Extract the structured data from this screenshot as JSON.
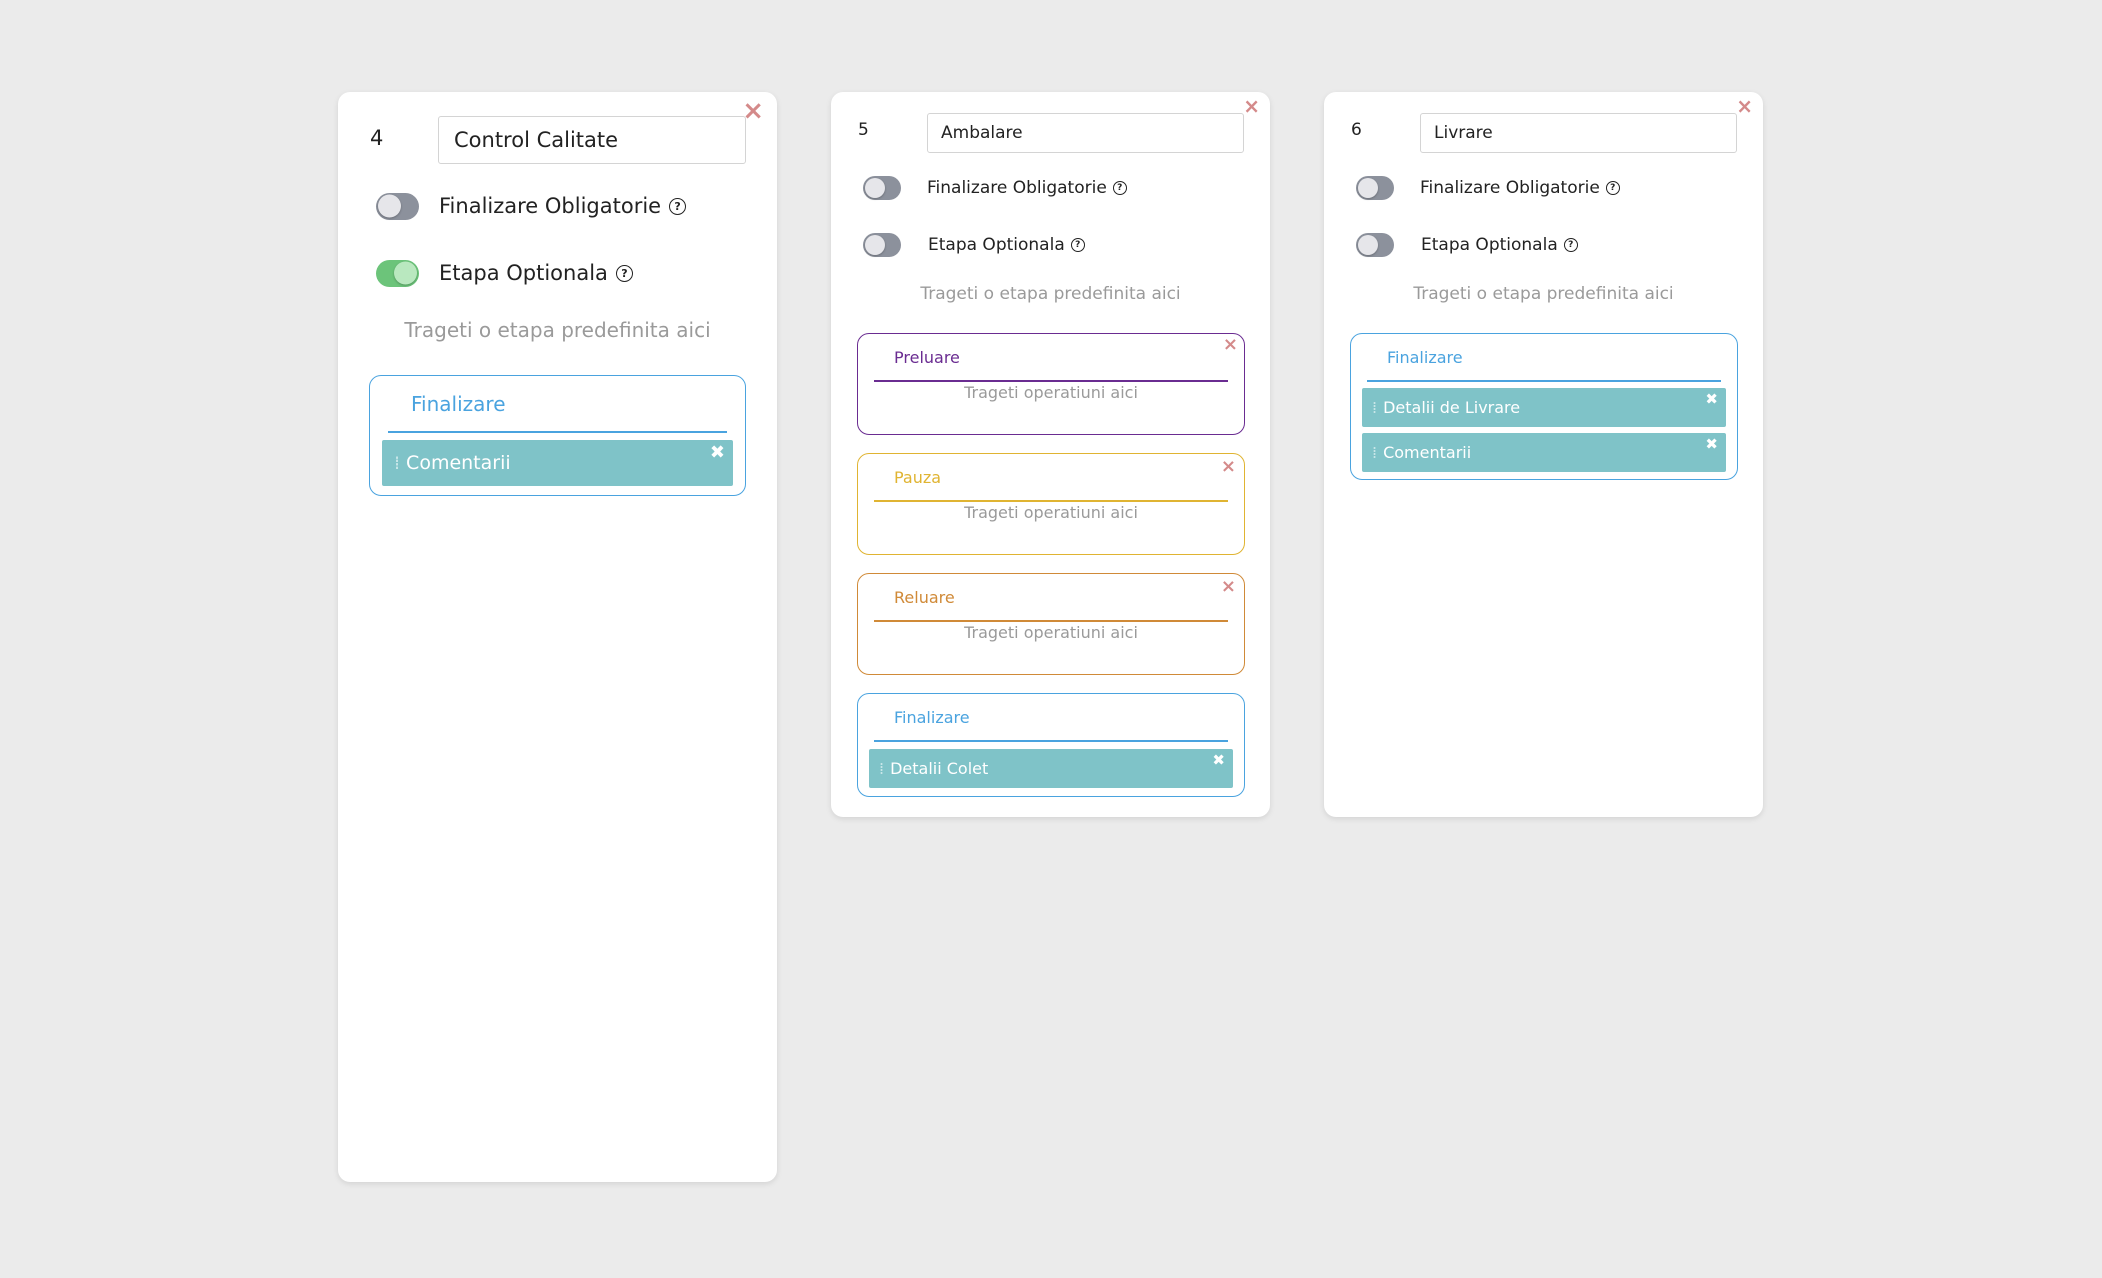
{
  "colors": {
    "background": "#ebebeb",
    "finalizare": "#4aa3df",
    "preluare": "#6a2c91",
    "pauza": "#e0b432",
    "reluare": "#d08a38",
    "operation_item": "#7fc3c8",
    "toggle_on": "#6cc47a",
    "toggle_off": "#8c919c",
    "close_icon": "#d48a8a"
  },
  "icons": {
    "close": "×",
    "help": "?",
    "item_close": "✖",
    "grip": "⁞"
  },
  "stages": [
    {
      "number": "4",
      "name_value": "Control Calitate",
      "toggle_final_label": "Finalizare Obligatorie",
      "toggle_final_on": false,
      "toggle_optional_label": "Etapa Optionala",
      "toggle_optional_on": true,
      "drop_hint": "Trageti o etapa predefinita aici",
      "sections": [
        {
          "title": "Finalizare",
          "items": [
            "Comentarii"
          ]
        }
      ]
    },
    {
      "number": "5",
      "name_value": "Ambalare",
      "toggle_final_label": "Finalizare Obligatorie",
      "toggle_final_on": false,
      "toggle_optional_label": "Etapa Optionala",
      "toggle_optional_on": false,
      "drop_hint": "Trageti o etapa predefinita aici",
      "sections": [
        {
          "title": "Preluare",
          "hint": "Trageti operatiuni aici"
        },
        {
          "title": "Pauza",
          "hint": "Trageti operatiuni aici"
        },
        {
          "title": "Reluare",
          "hint": "Trageti operatiuni aici"
        },
        {
          "title": "Finalizare",
          "items": [
            "Detalii Colet"
          ]
        }
      ]
    },
    {
      "number": "6",
      "name_value": "Livrare",
      "toggle_final_label": "Finalizare Obligatorie",
      "toggle_final_on": false,
      "toggle_optional_label": "Etapa Optionala",
      "toggle_optional_on": false,
      "drop_hint": "Trageti o etapa predefinita aici",
      "sections": [
        {
          "title": "Finalizare",
          "items": [
            "Detalii de Livrare",
            "Comentarii"
          ]
        }
      ]
    }
  ]
}
